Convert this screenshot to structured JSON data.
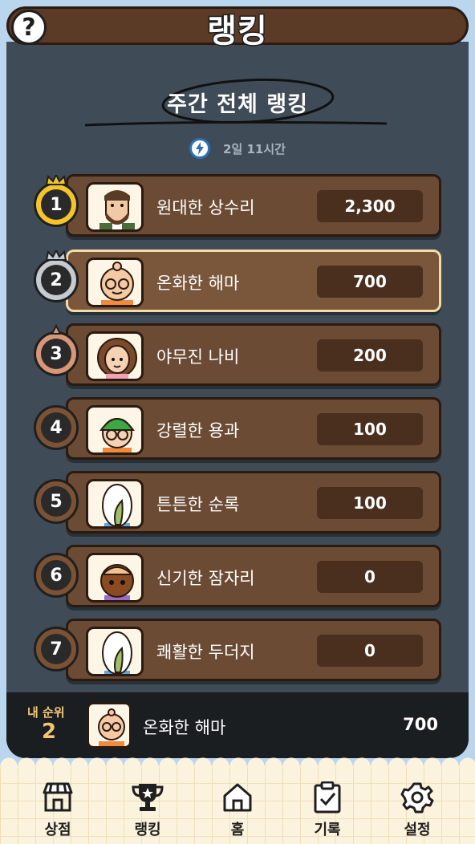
{
  "header": {
    "title": "랭킹",
    "help_icon": "?"
  },
  "ranking": {
    "subtitle": "주간 전체 랭킹",
    "timer": "2일 11시간",
    "entries": [
      {
        "rank": "1",
        "name": "원대한 상수리",
        "score": "2,300",
        "medal": "gold"
      },
      {
        "rank": "2",
        "name": "온화한 해마",
        "score": "700",
        "medal": "silver",
        "is_me": true
      },
      {
        "rank": "3",
        "name": "야무진 나비",
        "score": "200",
        "medal": "bronze"
      },
      {
        "rank": "4",
        "name": "강렬한 용과",
        "score": "100",
        "medal": "plain"
      },
      {
        "rank": "5",
        "name": "튼튼한 순록",
        "score": "100",
        "medal": "plain"
      },
      {
        "rank": "6",
        "name": "신기한 잠자리",
        "score": "0",
        "medal": "plain"
      },
      {
        "rank": "7",
        "name": "쾌활한 두더지",
        "score": "0",
        "medal": "plain"
      }
    ]
  },
  "my_rank": {
    "label": "내 순위",
    "rank": "2",
    "name": "온화한 해마",
    "score": "700"
  },
  "nav": [
    {
      "label": "상점",
      "icon": "shop-icon"
    },
    {
      "label": "랭킹",
      "icon": "trophy-icon"
    },
    {
      "label": "홈",
      "icon": "home-icon"
    },
    {
      "label": "기록",
      "icon": "clipboard-icon"
    },
    {
      "label": "설정",
      "icon": "gear-icon"
    }
  ],
  "colors": {
    "panel": "#3f4c57",
    "row": "#6b4b34",
    "accent_gold": "#f4c52b",
    "my_rank_label": "#f0c873"
  }
}
